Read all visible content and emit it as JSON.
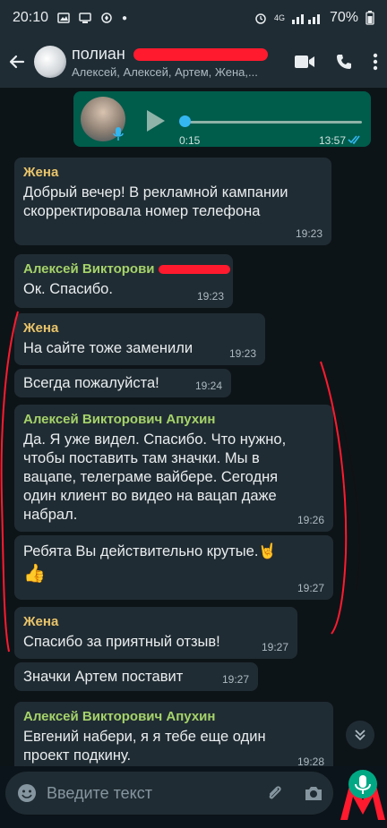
{
  "status_bar": {
    "time": "20:10",
    "battery": "70%",
    "network": "4G"
  },
  "header": {
    "title": "полиан",
    "subtitle": "Алексей, Алексей, Артем, Жена,..."
  },
  "voice_message": {
    "duration": "0:15",
    "time": "13:57",
    "progress": 0
  },
  "messages": [
    {
      "sender": "Жена",
      "text": "Добрый вечер! В рекламной кампании скорректировала номер телефона",
      "time": "19:23"
    },
    {
      "sender": "Алексей Викторови",
      "text": "Ок. Спасибо.",
      "time": "19:23"
    },
    {
      "sender": "Жена",
      "text": "На сайте тоже заменили",
      "time": "19:23"
    },
    {
      "sender": "",
      "text": "Всегда пожалуйста!",
      "time": "19:24"
    },
    {
      "sender": "Алексей Викторович Апухин",
      "text": "Да. Я уже видел. Спасибо. Что нужно, чтобы поставить там значки. Мы в вацапе, телеграме вайбере. Сегодня один клиент во видео на вацап даже набрал.",
      "time": "19:26"
    },
    {
      "sender": "",
      "text": "Ребята Вы действительно крутые.",
      "emoji1": "🤘",
      "emoji2": "👍",
      "time": "19:27"
    },
    {
      "sender": "Жена",
      "text": "Спасибо за приятный отзыв!",
      "time": "19:27"
    },
    {
      "sender": "",
      "text": "Значки Артем поставит",
      "time": "19:27"
    },
    {
      "sender": "Алексей Викторович Апухин",
      "text": "Евгений набери, я я тебе еще один проект подкину.",
      "time": "19:28"
    }
  ],
  "composer": {
    "placeholder": "Введите текст"
  },
  "colors": {
    "accent": "#005c4b",
    "incoming": "#202c33",
    "zhena_name": "#e9c46a",
    "aleksey_name": "#a5d36a",
    "tick": "#34b7f1",
    "annotation": "#ff1a2e"
  }
}
